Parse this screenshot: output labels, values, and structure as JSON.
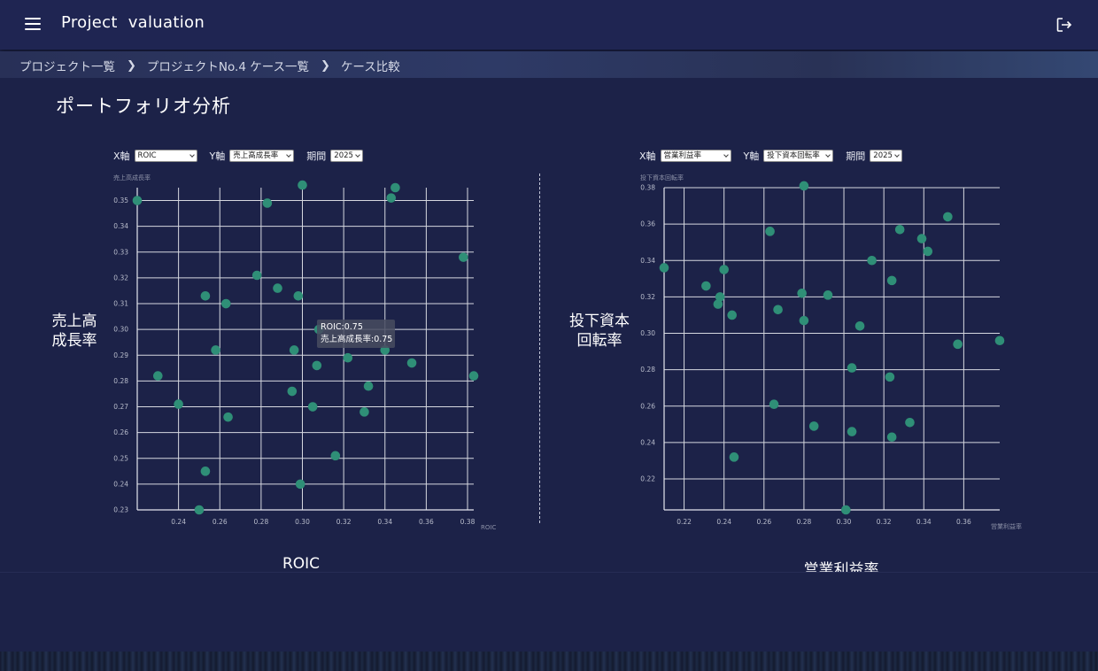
{
  "app": {
    "title": "Project  valuation"
  },
  "breadcrumb": [
    "プロジェクト一覧",
    "プロジェクトNo.4 ケース一覧",
    "ケース比較"
  ],
  "page": {
    "title": "ポートフォリオ分析"
  },
  "colors": {
    "point": "#2f8f77",
    "grid": "#d6d8e0",
    "background": "#1c2248"
  },
  "charts": [
    {
      "controls": {
        "x_label": "X軸",
        "x_value": "ROIC",
        "y_label": "Y軸",
        "y_value": "売上高成長率",
        "period_label": "期間",
        "period_value": "2025"
      },
      "axis_caption_y": "売上高成長率",
      "axis_caption_x": "ROIC",
      "y_title": "売上高\n成長率",
      "x_title": "ROIC",
      "tooltip": {
        "line1": "ROIC:0.75",
        "line2": "売上高成長率:0.75"
      }
    },
    {
      "controls": {
        "x_label": "X軸",
        "x_value": "営業利益率",
        "y_label": "Y軸",
        "y_value": "投下資本回転率",
        "period_label": "期間",
        "period_value": "2025"
      },
      "axis_caption_y": "投下資本回転率",
      "axis_caption_x": "営業利益率",
      "y_title": "投下資本\n回転率",
      "x_title": "営業利益率"
    }
  ],
  "chart_data": [
    {
      "type": "scatter",
      "title": "",
      "xlabel": "ROIC",
      "ylabel": "売上高成長率",
      "xlim": [
        0.22,
        0.383
      ],
      "ylim": [
        0.23,
        0.355
      ],
      "x_ticks": [
        0.24,
        0.26,
        0.28,
        0.3,
        0.32,
        0.34,
        0.36,
        0.38
      ],
      "y_ticks": [
        0.23,
        0.24,
        0.25,
        0.26,
        0.27,
        0.28,
        0.29,
        0.3,
        0.31,
        0.32,
        0.33,
        0.34,
        0.35
      ],
      "grid": true,
      "points": [
        {
          "x": 0.22,
          "y": 0.35
        },
        {
          "x": 0.23,
          "y": 0.282
        },
        {
          "x": 0.24,
          "y": 0.271
        },
        {
          "x": 0.25,
          "y": 0.23
        },
        {
          "x": 0.253,
          "y": 0.245
        },
        {
          "x": 0.253,
          "y": 0.313
        },
        {
          "x": 0.258,
          "y": 0.292
        },
        {
          "x": 0.263,
          "y": 0.31
        },
        {
          "x": 0.264,
          "y": 0.266
        },
        {
          "x": 0.278,
          "y": 0.321
        },
        {
          "x": 0.283,
          "y": 0.349
        },
        {
          "x": 0.288,
          "y": 0.316
        },
        {
          "x": 0.295,
          "y": 0.276
        },
        {
          "x": 0.296,
          "y": 0.292
        },
        {
          "x": 0.298,
          "y": 0.313
        },
        {
          "x": 0.299,
          "y": 0.24
        },
        {
          "x": 0.3,
          "y": 0.356
        },
        {
          "x": 0.305,
          "y": 0.27
        },
        {
          "x": 0.307,
          "y": 0.286
        },
        {
          "x": 0.308,
          "y": 0.3
        },
        {
          "x": 0.316,
          "y": 0.251
        },
        {
          "x": 0.322,
          "y": 0.289
        },
        {
          "x": 0.33,
          "y": 0.268
        },
        {
          "x": 0.332,
          "y": 0.278
        },
        {
          "x": 0.34,
          "y": 0.292
        },
        {
          "x": 0.343,
          "y": 0.351
        },
        {
          "x": 0.345,
          "y": 0.355
        },
        {
          "x": 0.353,
          "y": 0.287
        },
        {
          "x": 0.378,
          "y": 0.328
        },
        {
          "x": 0.383,
          "y": 0.282
        }
      ]
    },
    {
      "type": "scatter",
      "title": "",
      "xlabel": "営業利益率",
      "ylabel": "投下資本回転率",
      "xlim": [
        0.21,
        0.378
      ],
      "ylim": [
        0.203,
        0.38
      ],
      "x_ticks": [
        0.22,
        0.24,
        0.26,
        0.28,
        0.3,
        0.32,
        0.34,
        0.36
      ],
      "y_ticks": [
        0.22,
        0.24,
        0.26,
        0.28,
        0.3,
        0.32,
        0.34,
        0.36,
        0.38
      ],
      "grid": true,
      "points": [
        {
          "x": 0.21,
          "y": 0.336
        },
        {
          "x": 0.231,
          "y": 0.326
        },
        {
          "x": 0.237,
          "y": 0.316
        },
        {
          "x": 0.238,
          "y": 0.32
        },
        {
          "x": 0.24,
          "y": 0.335
        },
        {
          "x": 0.244,
          "y": 0.31
        },
        {
          "x": 0.245,
          "y": 0.232
        },
        {
          "x": 0.263,
          "y": 0.356
        },
        {
          "x": 0.265,
          "y": 0.261
        },
        {
          "x": 0.267,
          "y": 0.313
        },
        {
          "x": 0.279,
          "y": 0.322
        },
        {
          "x": 0.28,
          "y": 0.307
        },
        {
          "x": 0.28,
          "y": 0.381
        },
        {
          "x": 0.285,
          "y": 0.249
        },
        {
          "x": 0.292,
          "y": 0.321
        },
        {
          "x": 0.301,
          "y": 0.203
        },
        {
          "x": 0.304,
          "y": 0.246
        },
        {
          "x": 0.304,
          "y": 0.281
        },
        {
          "x": 0.308,
          "y": 0.304
        },
        {
          "x": 0.314,
          "y": 0.34
        },
        {
          "x": 0.323,
          "y": 0.276
        },
        {
          "x": 0.324,
          "y": 0.243
        },
        {
          "x": 0.324,
          "y": 0.329
        },
        {
          "x": 0.328,
          "y": 0.357
        },
        {
          "x": 0.333,
          "y": 0.251
        },
        {
          "x": 0.339,
          "y": 0.352
        },
        {
          "x": 0.342,
          "y": 0.345
        },
        {
          "x": 0.352,
          "y": 0.364
        },
        {
          "x": 0.357,
          "y": 0.294
        },
        {
          "x": 0.378,
          "y": 0.296
        }
      ]
    }
  ]
}
